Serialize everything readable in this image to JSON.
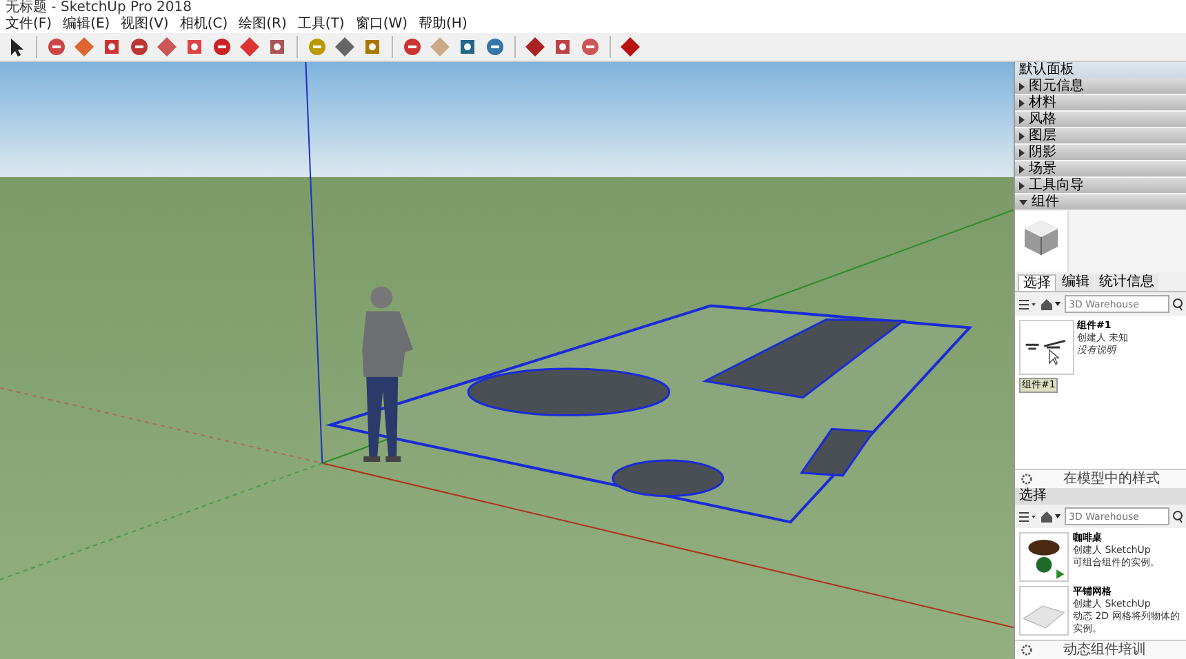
{
  "window": {
    "title": "无标题 - SketchUp Pro 2018"
  },
  "menu": [
    "文件(F)",
    "编辑(E)",
    "视图(V)",
    "相机(C)",
    "绘图(R)",
    "工具(T)",
    "窗口(W)",
    "帮助(H)"
  ],
  "panel": {
    "title": "默认面板",
    "sections": [
      {
        "label": "图元信息",
        "expanded": false
      },
      {
        "label": "材料",
        "expanded": false
      },
      {
        "label": "风格",
        "expanded": false
      },
      {
        "label": "图层",
        "expanded": false
      },
      {
        "label": "阴影",
        "expanded": false
      },
      {
        "label": "场景",
        "expanded": false
      },
      {
        "label": "工具向导",
        "expanded": false
      },
      {
        "label": "组件",
        "expanded": true
      }
    ],
    "tabs": [
      {
        "label": "选择",
        "selected": true
      },
      {
        "label": "编辑",
        "selected": false
      },
      {
        "label": "统计信息",
        "selected": false
      }
    ],
    "search": {
      "placeholder": "3D Warehouse"
    },
    "component": {
      "name": "组件#1",
      "author": "创建人 未知",
      "description": "没有说明",
      "tag": "组件#1"
    },
    "footer": "在模型中的样式",
    "lower": {
      "header": "选择",
      "search": {
        "placeholder": "3D Warehouse"
      },
      "items": [
        {
          "name": "咖啡桌",
          "author": "创建人 SketchUp",
          "description": "可组合组件的实例。"
        },
        {
          "name": "平铺网格",
          "author": "创建人 SketchUp",
          "description": "动态 2D 网格将列物体的实例。"
        }
      ],
      "footer": "动态组件培训"
    }
  }
}
